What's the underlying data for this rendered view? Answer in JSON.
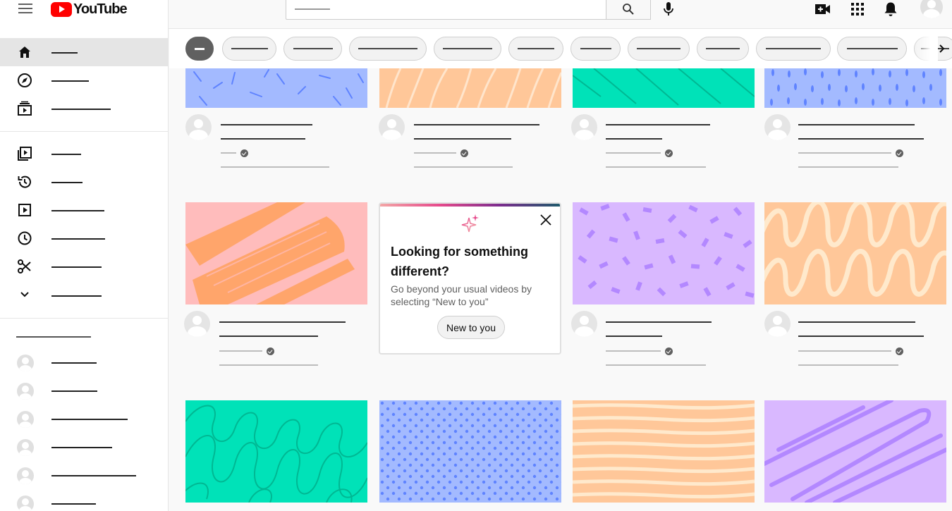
{
  "app": {
    "logo_text": "YouTube",
    "brand_color": "#ff0000"
  },
  "sidebar": {
    "items": [
      {
        "icon": "home-icon"
      },
      {
        "icon": "compass-icon"
      },
      {
        "icon": "subscriptions-icon"
      },
      {
        "icon": "library-icon"
      },
      {
        "icon": "history-icon"
      },
      {
        "icon": "your-videos-icon"
      },
      {
        "icon": "watch-later-icon"
      },
      {
        "icon": "scissors-icon"
      },
      {
        "icon": "chevron-down-icon"
      }
    ]
  },
  "topbar": {
    "icons": [
      "search-icon",
      "mic-icon",
      "create-video-icon",
      "apps-grid-icon",
      "bell-icon",
      "user-avatar"
    ]
  },
  "popup": {
    "title": "Looking for something different?",
    "body": "Go beyond your usual videos by selecting “New to you”",
    "button_label": "New to you",
    "icon": "sparkle-icon",
    "gradient_colors": [
      "#f3a6a6",
      "#e64a8c",
      "#7b2d8e",
      "#1e5a6b"
    ]
  },
  "thumbnail_colors": {
    "blue": "#a3baff",
    "orange": "#ffc799",
    "teal": "#00e2b8",
    "pink": "#ffbcbc",
    "purple": "#d9b8ff"
  }
}
